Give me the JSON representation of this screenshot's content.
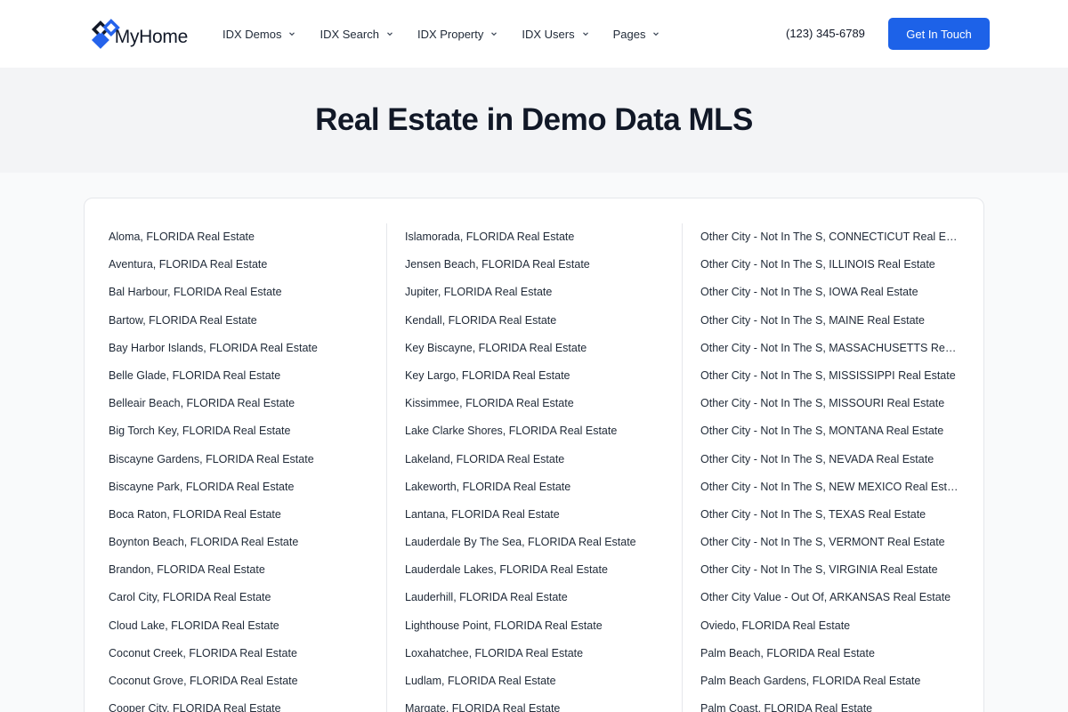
{
  "header": {
    "logo_text": "MyHome",
    "nav": [
      {
        "label": "IDX Demos"
      },
      {
        "label": "IDX Search"
      },
      {
        "label": "IDX Property"
      },
      {
        "label": "IDX Users"
      },
      {
        "label": "Pages"
      }
    ],
    "phone": "(123) 345-6789",
    "cta_label": "Get In Touch"
  },
  "hero": {
    "title": "Real Estate in Demo Data MLS"
  },
  "colors": {
    "accent": "#1d62e8",
    "logo_blue": "#2563eb",
    "logo_dark": "#111827"
  },
  "columns": [
    [
      "Aloma, FLORIDA Real Estate",
      "Aventura, FLORIDA Real Estate",
      "Bal Harbour, FLORIDA Real Estate",
      "Bartow, FLORIDA Real Estate",
      "Bay Harbor Islands, FLORIDA Real Estate",
      "Belle Glade, FLORIDA Real Estate",
      "Belleair Beach, FLORIDA Real Estate",
      "Big Torch Key, FLORIDA Real Estate",
      "Biscayne Gardens, FLORIDA Real Estate",
      "Biscayne Park, FLORIDA Real Estate",
      "Boca Raton, FLORIDA Real Estate",
      "Boynton Beach, FLORIDA Real Estate",
      "Brandon, FLORIDA Real Estate",
      "Carol City, FLORIDA Real Estate",
      "Cloud Lake, FLORIDA Real Estate",
      "Coconut Creek, FLORIDA Real Estate",
      "Coconut Grove, FLORIDA Real Estate",
      "Cooper City, FLORIDA Real Estate"
    ],
    [
      "Islamorada, FLORIDA Real Estate",
      "Jensen Beach, FLORIDA Real Estate",
      "Jupiter, FLORIDA Real Estate",
      "Kendall, FLORIDA Real Estate",
      "Key Biscayne, FLORIDA Real Estate",
      "Key Largo, FLORIDA Real Estate",
      "Kissimmee, FLORIDA Real Estate",
      "Lake Clarke Shores, FLORIDA Real Estate",
      "Lakeland, FLORIDA Real Estate",
      "Lakeworth, FLORIDA Real Estate",
      "Lantana, FLORIDA Real Estate",
      "Lauderdale By The Sea, FLORIDA Real Estate",
      "Lauderdale Lakes, FLORIDA Real Estate",
      "Lauderhill, FLORIDA Real Estate",
      "Lighthouse Point, FLORIDA Real Estate",
      "Loxahatchee, FLORIDA Real Estate",
      "Ludlam, FLORIDA Real Estate",
      "Margate, FLORIDA Real Estate"
    ],
    [
      "Other City - Not In The S, CONNECTICUT Real Estate",
      "Other City - Not In The S, ILLINOIS Real Estate",
      "Other City - Not In The S, IOWA Real Estate",
      "Other City - Not In The S, MAINE Real Estate",
      "Other City - Not In The S, MASSACHUSETTS Real Estate",
      "Other City - Not In The S, MISSISSIPPI Real Estate",
      "Other City - Not In The S, MISSOURI Real Estate",
      "Other City - Not In The S, MONTANA Real Estate",
      "Other City - Not In The S, NEVADA Real Estate",
      "Other City - Not In The S, NEW MEXICO Real Estate",
      "Other City - Not In The S, TEXAS Real Estate",
      "Other City - Not In The S, VERMONT Real Estate",
      "Other City - Not In The S, VIRGINIA Real Estate",
      "Other City Value - Out Of, ARKANSAS Real Estate",
      "Oviedo, FLORIDA Real Estate",
      "Palm Beach, FLORIDA Real Estate",
      "Palm Beach Gardens, FLORIDA Real Estate",
      "Palm Coast, FLORIDA Real Estate"
    ]
  ]
}
